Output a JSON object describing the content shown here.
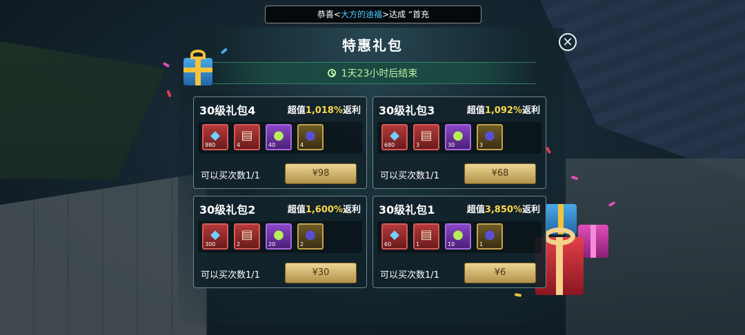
{
  "announcement": {
    "prefix": "恭喜<",
    "name": "大方的迪福",
    "suffix": ">达成 “首充"
  },
  "title": "特惠礼包",
  "timer": "1天23小时后结束",
  "close_icon": "close-icon",
  "packs": [
    {
      "name": "30级礼包4",
      "value_prefix": "超值",
      "value_pct": "1,018%",
      "value_suffix": "返利",
      "items": [
        {
          "icon": "diamond-icon",
          "count": "980",
          "rarity": "red"
        },
        {
          "icon": "scroll-icon",
          "count": "4",
          "rarity": "red"
        },
        {
          "icon": "potion-icon",
          "count": "40",
          "rarity": "purple"
        },
        {
          "icon": "berry-icon",
          "count": "4",
          "rarity": "gold"
        }
      ],
      "buy_limit": "可以买次数1/1",
      "price": "¥98"
    },
    {
      "name": "30级礼包3",
      "value_prefix": "超值",
      "value_pct": "1,092%",
      "value_suffix": "返利",
      "items": [
        {
          "icon": "diamond-icon",
          "count": "680",
          "rarity": "red"
        },
        {
          "icon": "scroll-icon",
          "count": "3",
          "rarity": "red"
        },
        {
          "icon": "potion-icon",
          "count": "30",
          "rarity": "purple"
        },
        {
          "icon": "berry-icon",
          "count": "3",
          "rarity": "gold"
        }
      ],
      "buy_limit": "可以买次数1/1",
      "price": "¥68"
    },
    {
      "name": "30级礼包2",
      "value_prefix": "超值",
      "value_pct": "1,600%",
      "value_suffix": "返利",
      "items": [
        {
          "icon": "diamond-icon",
          "count": "300",
          "rarity": "red"
        },
        {
          "icon": "scroll-icon",
          "count": "2",
          "rarity": "red"
        },
        {
          "icon": "potion-icon",
          "count": "20",
          "rarity": "purple"
        },
        {
          "icon": "berry-icon",
          "count": "2",
          "rarity": "gold"
        }
      ],
      "buy_limit": "可以买次数1/1",
      "price": "¥30"
    },
    {
      "name": "30级礼包1",
      "value_prefix": "超值",
      "value_pct": "3,850%",
      "value_suffix": "返利",
      "items": [
        {
          "icon": "diamond-icon",
          "count": "60",
          "rarity": "red"
        },
        {
          "icon": "scroll-icon",
          "count": "1",
          "rarity": "red"
        },
        {
          "icon": "potion-icon",
          "count": "10",
          "rarity": "purple"
        },
        {
          "icon": "berry-icon",
          "count": "1",
          "rarity": "gold"
        }
      ],
      "buy_limit": "可以买次数1/1",
      "price": "¥6"
    }
  ]
}
